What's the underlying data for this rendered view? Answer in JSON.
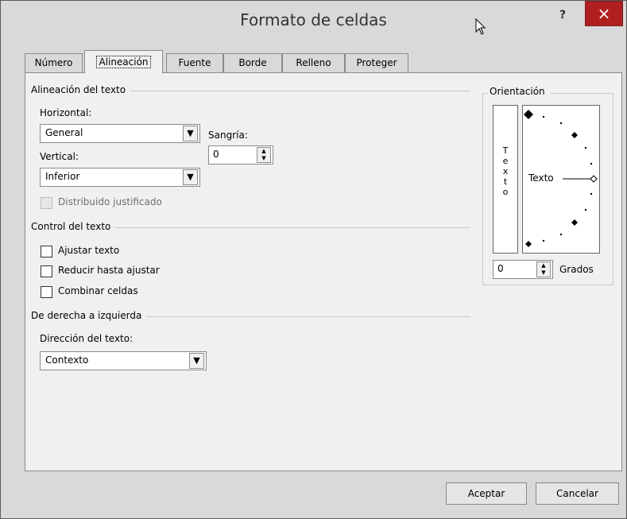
{
  "window": {
    "title": "Formato de celdas",
    "help_label": "?",
    "close_label": "×"
  },
  "tabs": [
    {
      "label": "Número"
    },
    {
      "label": "Alineación"
    },
    {
      "label": "Fuente"
    },
    {
      "label": "Borde"
    },
    {
      "label": "Relleno"
    },
    {
      "label": "Proteger"
    }
  ],
  "text_alignment": {
    "section_title": "Alineación del texto",
    "horizontal_label": "Horizontal:",
    "horizontal_value": "General",
    "vertical_label": "Vertical:",
    "vertical_value": "Inferior",
    "indent_label": "Sangría:",
    "indent_value": "0",
    "justify_distributed_label": "Distribuido justificado"
  },
  "text_control": {
    "section_title": "Control del texto",
    "wrap_text_label": "Ajustar texto",
    "shrink_to_fit_label": "Reducir hasta ajustar",
    "merge_cells_label": "Combinar celdas"
  },
  "rtl": {
    "section_title": "De derecha a izquierda",
    "direction_label": "Dirección del texto:",
    "direction_value": "Contexto"
  },
  "orientation": {
    "section_title": "Orientación",
    "vertical_text_letters": [
      "T",
      "e",
      "x",
      "t",
      "o"
    ],
    "dial_text": "Texto",
    "degrees_value": "0",
    "degrees_label": "Grados"
  },
  "buttons": {
    "ok_label": "Aceptar",
    "cancel_label": "Cancelar"
  }
}
